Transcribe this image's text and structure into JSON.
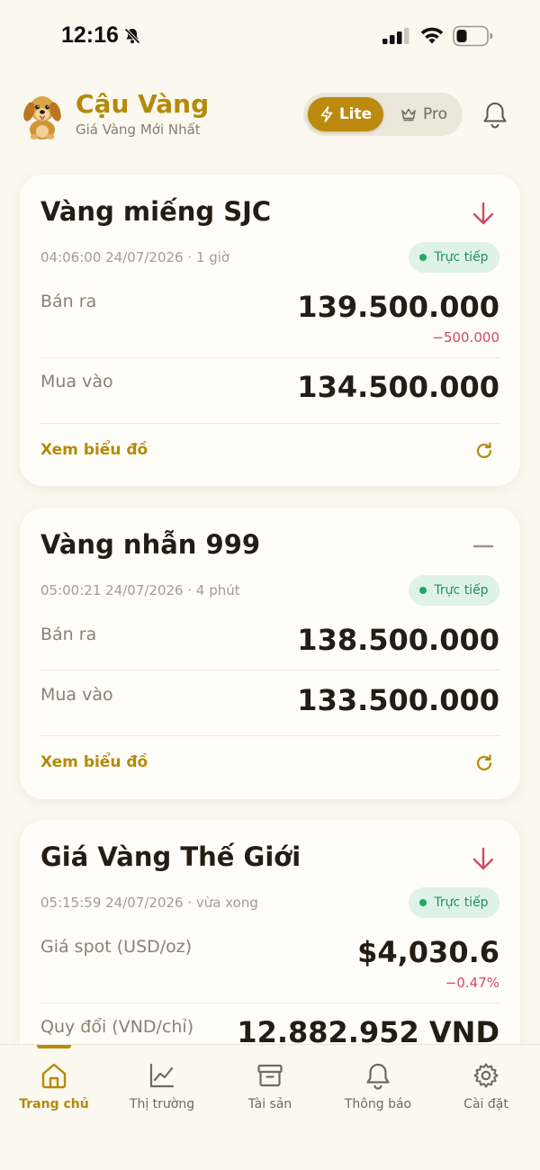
{
  "status_bar": {
    "time": "12:16",
    "icons": [
      "bell-slash-icon",
      "signal-icon",
      "wifi-icon",
      "battery-icon"
    ]
  },
  "header": {
    "title": "Cậu Vàng",
    "subtitle": "Giá Vàng Mới Nhất",
    "logo": "golden-dog-logo",
    "mode_toggle": {
      "lite": "Lite",
      "pro": "Pro",
      "selected": "Lite"
    },
    "bell_icon": "bell-icon"
  },
  "colors": {
    "brand_gold": "#b48a0a",
    "background": "#fbf8ef",
    "down_red": "#d14a63",
    "live_green": "#21915b"
  },
  "cards": [
    {
      "title": "Vàng miếng SJC",
      "trend": "down-arrow-icon",
      "timestamp": "04:06:00 24/07/2026 · 1 giờ",
      "badge": "Trực tiếp",
      "sell_label": "Bán ra",
      "sell_value": "139.500.000",
      "sell_change": "−500.000",
      "buy_label": "Mua vào",
      "buy_value": "134.500.000",
      "chart_link": "Xem biểu đồ"
    },
    {
      "title": "Vàng nhẫn 999",
      "trend": "flat-dash-icon",
      "timestamp": "05:00:21 24/07/2026 · 4 phút",
      "badge": "Trực tiếp",
      "sell_label": "Bán ra",
      "sell_value": "138.500.000",
      "buy_label": "Mua vào",
      "buy_value": "133.500.000",
      "chart_link": "Xem biểu đồ"
    },
    {
      "title": "Giá Vàng Thế Giới",
      "trend": "down-arrow-icon",
      "timestamp": "05:15:59 24/07/2026 · vừa xong",
      "badge": "Trực tiếp",
      "spot_label": "Giá spot (USD/oz)",
      "spot_value": "$4,030.6",
      "spot_change": "−0.47%",
      "convert_label": "Quy đổi (VND/chỉ)",
      "convert_value": "12.882.952 VND"
    }
  ],
  "bottom_nav": {
    "active": "Trang chủ",
    "items": [
      {
        "label": "Trang chủ",
        "icon": "home-icon"
      },
      {
        "label": "Thị trường",
        "icon": "chart-icon"
      },
      {
        "label": "Tài sản",
        "icon": "archive-icon"
      },
      {
        "label": "Thông báo",
        "icon": "bell-icon"
      },
      {
        "label": "Cài đặt",
        "icon": "gear-icon"
      }
    ]
  }
}
